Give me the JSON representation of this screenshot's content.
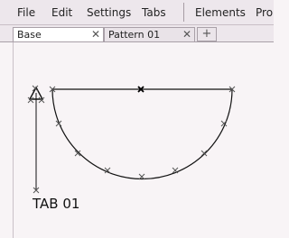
{
  "menu": [
    "File",
    "Edit",
    "Settings",
    "Tabs",
    "Elements",
    "Pro"
  ],
  "tabs": [
    {
      "label": "Base",
      "close": "✕"
    },
    {
      "label": "Pattern 01",
      "close": "✕"
    }
  ],
  "add_tab_label": "+",
  "drawing": {
    "label": "TAB 01"
  }
}
